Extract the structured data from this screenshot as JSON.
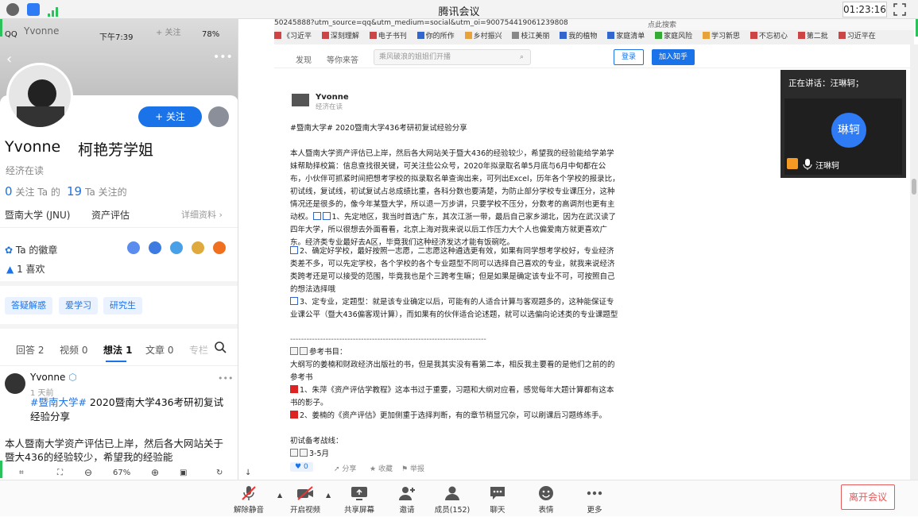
{
  "window": {
    "title": "腾讯会议",
    "clock": "01:23:16"
  },
  "phone": {
    "status_time": "下午7:39",
    "status_carrier": "QQ",
    "status_battery": "78%",
    "header_name_faded": "Yvonne",
    "header_follow_faded": "+ 关注",
    "follow_button": "+ 关注",
    "name": "Yvonne",
    "fullname": "柯艳芳学姐",
    "subtitle": "经济在读",
    "following_count": "0",
    "following_label": "关注 Ta 的",
    "followers_count": "19",
    "followers_label": "Ta 关注的",
    "school": "暨南大学 (JNU)",
    "major": "资产评估",
    "detail_link": "详细资料 ›",
    "badge_label": "Ta 的徽章",
    "likes": "1 喜欢",
    "tags": [
      "答疑解惑",
      "爱学习",
      "研究生"
    ],
    "tabs": [
      "回答 2",
      "视频 0",
      "想法 1",
      "文章 0",
      "专栏"
    ],
    "post": {
      "author": "Yvonne",
      "time": "1 天前",
      "title_hash": "#暨南大学#",
      "title_rest": " 2020暨南大学436考研初复试经验分享",
      "body": "本人暨南大学资产评估已上岸，然后各大网站关于暨大436的经验较少，希望我的经验能"
    },
    "zoom": "67%"
  },
  "browser": {
    "url": "50245888?utm_source=qq&utm_medium=social&utm_oi=900754419061239808",
    "search_hint": "点此搜索",
    "bookmarks": [
      "《习近平",
      "深刻理解",
      "电子书刊",
      "你的所作",
      "乡村振兴",
      "枝江美丽",
      "我的植物",
      "家庭清单",
      "家庭风险",
      "学习新思",
      "不忘初心",
      "第二批",
      "习近平在"
    ],
    "nav": [
      "发现",
      "等你来答"
    ],
    "search_placeholder": "乘风破浪的姐姐们开播",
    "login": "登录",
    "join": "加入知乎"
  },
  "article": {
    "author": "Yvonne",
    "author_sub": "经济在读",
    "title": "#暨南大学# 2020暨南大学436考研初复试经验分享",
    "p1": "本人暨南大学资产评估已上岸，然后各大网站关于暨大436的经验较少，希望我的经验能给学弟学妹帮助择校篇：信息查找很关键，可关注些公众号，2020年拟录取名单5月底与6月中旬都在公布，小伙伴可抓紧时间把想考学校的拟录取名单查询出来，可列出Excel，历年各个学校的报录比，初试线，复试线，初试复试占总成绩比重，各科分数也要清楚，为防止部分学校专业课压分，这种情况还是很多的，像今年某暨大学，所以退一万步讲，只要学校不压分，分数考的高调剂也更有主动权。",
    "p1b": "1、先定地区，我当时首选广东，其次江浙一带，最后自己家乡湖北，因为在武汉读了四年大学，所以很想去外面看看，北京上海对我来说以后工作压力大个人也偏爱南方就更喜欢广东。经济类专业最好去A区，毕竟我们这种经济发达才能有饭碗吃。",
    "p2": "2、确定好学校，最好按照一志愿，二志愿这种遴选更有效，如果有同学想考学校好，专业经济类差不多，可以先定学校，各个学校的各个专业题型不同可以选择自己喜欢的专业，就我来说经济类跨考还是可以接受的范围，毕竟我也是个三跨考生嘛；但是如果是确定该专业不可，可按照自己的想法选择哦",
    "p3": "3、定专业，定题型：就是该专业确定以后，可能有的人适合计算与客观题多的，这种能保证专业课公平（暨大436偏客观计算），而如果有的伙伴适合论述题，就可以选偏向论述类的专业课题型",
    "separator": "------------------------------------------------------------------------",
    "ref_title": "参考书目：",
    "ref_intro": "大纲写的姜楠和财政经济出版社的书，但是我其实没有看第二本，相反我主要看的是他们之前的的参考书",
    "ref1": "1、朱萍《资产评估学教程》这本书过于重要，习题和大纲对应看，感觉每年大题计算都有这本书的影子。",
    "ref2": "2、姜楠的《资产评估》更加侧重于选择判断，有的章节稍显冗杂，可以刷课后习题练练手。",
    "timeline_title": "初试备考战线：",
    "timeline_item": "3-5月",
    "vote_count": "0",
    "share": "分享",
    "favorite": "收藏",
    "report": "举报"
  },
  "speaker": {
    "label": "正在讲话：汪琳轲；",
    "avatar_text": "琳轲",
    "name": "汪琳轲"
  },
  "toolbar": {
    "items": [
      "解除静音",
      "开启视频",
      "共享屏幕",
      "邀请",
      "成员(152)",
      "聊天",
      "表情",
      "更多"
    ],
    "leave": "离开会议"
  },
  "colors": {
    "accent": "#1a73e8",
    "speaker_avatar": "#2f7bf5",
    "leave": "#e35b5b",
    "mute_red": "#e33"
  }
}
